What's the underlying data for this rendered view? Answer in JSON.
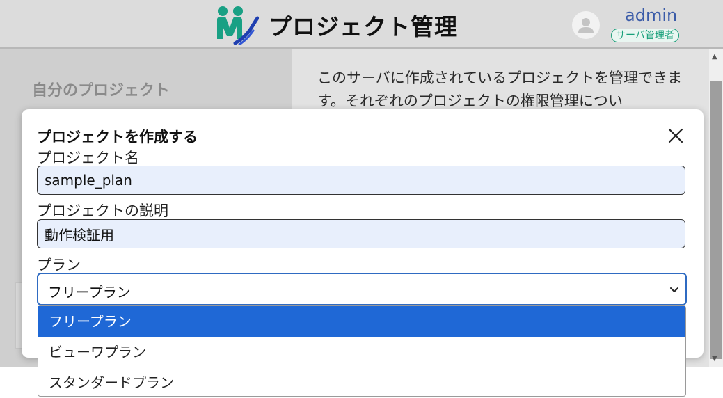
{
  "header": {
    "title": "プロジェクト管理",
    "user_name": "admin",
    "user_role": "サーバ管理者"
  },
  "sidebar": {
    "heading": "自分のプロジェクト"
  },
  "main": {
    "description": "このサーバに作成されているプロジェクトを管理できます。それぞれのプロジェクトの権限管理につい"
  },
  "modal": {
    "title": "プロジェクトを作成する",
    "name_label": "プロジェクト名",
    "name_value": "sample_plan",
    "description_label": "プロジェクトの説明",
    "description_value": "動作検証用",
    "plan_label": "プラン",
    "plan_selected": "フリープラン"
  },
  "plan_options": [
    {
      "label": "フリープラン",
      "selected": true
    },
    {
      "label": "ビューワプラン",
      "selected": false
    },
    {
      "label": "スタンダードプラン",
      "selected": false
    }
  ],
  "colors": {
    "accent": "#1f68d6",
    "role_badge": "#18a07a",
    "user_name": "#3a5ba8"
  }
}
